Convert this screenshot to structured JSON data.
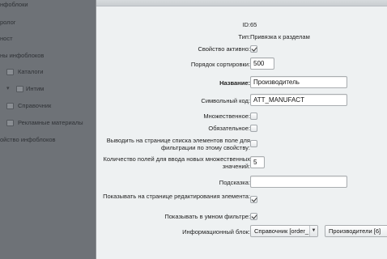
{
  "sidebar": {
    "items": [
      {
        "label": "нфоблоки"
      },
      {
        "label": "ролог"
      },
      {
        "label": "ност"
      },
      {
        "label": "ны инфоблоков"
      },
      {
        "label": "Каталоги"
      },
      {
        "label": "Интим"
      },
      {
        "label": "Справочник"
      },
      {
        "label": "Рекламные материалы"
      },
      {
        "label": "ойство инфоблоков"
      }
    ]
  },
  "form": {
    "id": {
      "label": "ID:",
      "value": "65"
    },
    "type": {
      "label": "Тип:",
      "value": "Привязка к разделам"
    },
    "active": {
      "label": "Свойство активно:",
      "checked": true
    },
    "sort": {
      "label": "Порядок сортировки:",
      "value": "500"
    },
    "name": {
      "label": "Название:",
      "value": "Производитель"
    },
    "code": {
      "label": "Символьный код:",
      "value": "ATT_MANUFACT"
    },
    "multiple": {
      "label": "Множественное:",
      "checked": false
    },
    "required": {
      "label": "Обязательное:",
      "checked": false
    },
    "filter": {
      "label": "Выводить на странице списка элементов поле для фильтрации по этому свойству:",
      "checked": false
    },
    "count": {
      "label": "Количество полей для ввода новых множественных значений:",
      "value": "5"
    },
    "hint": {
      "label": "Подсказка:",
      "value": ""
    },
    "show_edit": {
      "label": "Показывать на странице редактирования элемента:",
      "checked": true
    },
    "smart_filter": {
      "label": "Показывать в умном фильтре:",
      "checked": true
    },
    "iblock": {
      "label": "Информационный блок:",
      "select1": "Справочник [order_",
      "select2": "Производители [6]"
    }
  }
}
